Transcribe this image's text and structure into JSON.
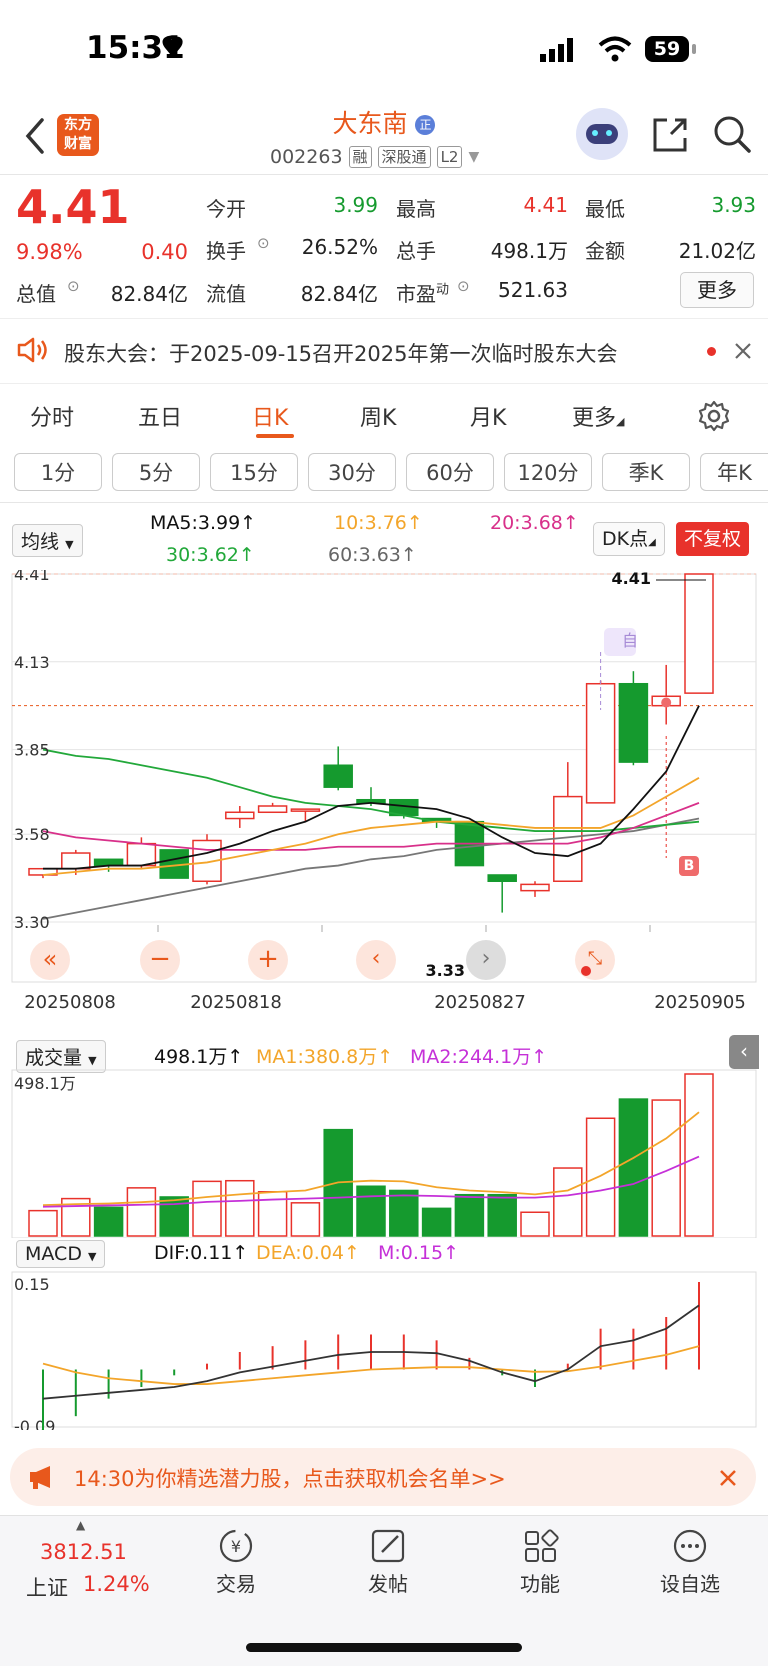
{
  "status": {
    "time": "15:31",
    "battery": "59"
  },
  "header": {
    "logo_line1": "东方",
    "logo_line2": "财富",
    "stock_name": "大东南",
    "name_badge": "正",
    "stock_code": "002263",
    "tags": [
      "融",
      "深股通",
      "L2"
    ]
  },
  "quote": {
    "price": "4.41",
    "change_pct": "9.98%",
    "change": "0.40",
    "open_label": "今开",
    "open": "3.99",
    "high_label": "最高",
    "high": "4.41",
    "low_label": "最低",
    "low": "3.93",
    "turnover_label": "换手",
    "turnover": "26.52%",
    "volume_label": "总手",
    "volume": "498.1万",
    "amount_label": "金额",
    "amount": "21.02亿",
    "mktcap_label": "总值",
    "mktcap": "82.84亿",
    "float_label": "流值",
    "float_cap": "82.84亿",
    "pe_label": "市盈",
    "pe_sup": "动",
    "pe": "521.63",
    "more": "更多"
  },
  "notice": {
    "text": "股东大会：于2025-09-15召开2025年第一次临时股东大会"
  },
  "period_tabs": [
    "分时",
    "五日",
    "日K",
    "周K",
    "月K",
    "更多"
  ],
  "active_period": "日K",
  "interval_buttons": [
    "1分",
    "5分",
    "15分",
    "30分",
    "60分",
    "120分",
    "季K",
    "年K"
  ],
  "ma": {
    "selector": "均线",
    "ma5": "MA5:3.99↑",
    "ma10": "10:3.76↑",
    "ma20": "20:3.68↑",
    "ma30": "30:3.62↑",
    "ma60": "60:3.63↑",
    "dk": "DK点",
    "fq": "不复权"
  },
  "kline": {
    "y_labels": [
      "4.41",
      "4.13",
      "3.85",
      "3.58",
      "3.30"
    ],
    "x_labels": [
      "20250808",
      "20250818",
      "20250827",
      "20250905"
    ],
    "high_marker": "4.41",
    "low_marker": "3.33",
    "zi": "自",
    "b_marker": "B"
  },
  "volume": {
    "selector": "成交量",
    "value": "498.1万↑",
    "ma1": "MA1:380.8万↑",
    "ma2": "MA2:244.1万↑",
    "y_max": "498.1万"
  },
  "macd": {
    "selector": "MACD",
    "dif": "DIF:0.11↑",
    "dea": "DEA:0.04↑",
    "m": "M:0.15↑",
    "y_max": "0.15",
    "y_min": "-0.09"
  },
  "promo": {
    "text": "14:30为你精选潜力股，点击获取机会名单>>"
  },
  "bottom_nav": {
    "index_value": "3812.51",
    "index_name": "上证",
    "index_change": "1.24%",
    "items": [
      "交易",
      "发帖",
      "功能",
      "设自选"
    ]
  },
  "colors": {
    "up": "#e8322b",
    "down": "#159a2e",
    "accent": "#e8581c",
    "ma5": "#111111",
    "ma10": "#f3a52a",
    "ma20": "#d8308a",
    "ma30": "#22a83a",
    "ma60": "#777777"
  },
  "chart_data": {
    "type": "candlestick",
    "dates": [
      "20250808",
      "",
      "",
      "",
      "",
      "20250818",
      "",
      "",
      "",
      "",
      "",
      "",
      "",
      "20250827",
      "",
      "",
      "",
      "",
      "",
      "20250905"
    ],
    "ohlc": [
      [
        3.45,
        3.47,
        3.44,
        3.47
      ],
      [
        3.47,
        3.53,
        3.45,
        3.52
      ],
      [
        3.5,
        3.5,
        3.46,
        3.48
      ],
      [
        3.48,
        3.57,
        3.47,
        3.55
      ],
      [
        3.53,
        3.53,
        3.44,
        3.44
      ],
      [
        3.43,
        3.58,
        3.42,
        3.56
      ],
      [
        3.63,
        3.67,
        3.6,
        3.65
      ],
      [
        3.65,
        3.68,
        3.65,
        3.67
      ],
      [
        3.66,
        3.66,
        3.62,
        3.66
      ],
      [
        3.8,
        3.86,
        3.72,
        3.73
      ],
      [
        3.69,
        3.73,
        3.67,
        3.68
      ],
      [
        3.69,
        3.69,
        3.63,
        3.64
      ],
      [
        3.63,
        3.63,
        3.6,
        3.62
      ],
      [
        3.62,
        3.62,
        3.48,
        3.48
      ],
      [
        3.45,
        3.45,
        3.33,
        3.43
      ],
      [
        3.4,
        3.43,
        3.38,
        3.42
      ],
      [
        3.43,
        3.81,
        3.43,
        3.7
      ],
      [
        3.68,
        4.07,
        3.68,
        4.06
      ],
      [
        4.06,
        4.1,
        3.8,
        3.81
      ],
      [
        3.99,
        4.12,
        3.93,
        4.02
      ],
      [
        4.03,
        4.41,
        4.03,
        4.41
      ]
    ],
    "ma5": [
      3.47,
      3.47,
      3.48,
      3.48,
      3.5,
      3.52,
      3.55,
      3.59,
      3.62,
      3.67,
      3.68,
      3.67,
      3.66,
      3.63,
      3.57,
      3.52,
      3.51,
      3.55,
      3.66,
      3.78,
      3.99
    ],
    "ma10": [
      3.45,
      3.46,
      3.47,
      3.47,
      3.48,
      3.49,
      3.51,
      3.53,
      3.55,
      3.58,
      3.6,
      3.61,
      3.62,
      3.62,
      3.61,
      3.6,
      3.6,
      3.6,
      3.64,
      3.7,
      3.76
    ],
    "ma20": [
      3.59,
      3.57,
      3.56,
      3.55,
      3.54,
      3.53,
      3.53,
      3.53,
      3.53,
      3.54,
      3.54,
      3.54,
      3.55,
      3.55,
      3.55,
      3.55,
      3.55,
      3.57,
      3.6,
      3.64,
      3.68
    ],
    "ma30": [
      3.85,
      3.83,
      3.82,
      3.8,
      3.78,
      3.76,
      3.73,
      3.7,
      3.68,
      3.67,
      3.66,
      3.64,
      3.62,
      3.61,
      3.6,
      3.59,
      3.59,
      3.59,
      3.6,
      3.61,
      3.62
    ],
    "ma60": [
      3.31,
      3.33,
      3.35,
      3.37,
      3.39,
      3.41,
      3.43,
      3.45,
      3.47,
      3.48,
      3.5,
      3.51,
      3.53,
      3.54,
      3.55,
      3.56,
      3.57,
      3.58,
      3.59,
      3.61,
      3.63
    ],
    "volume": [
      78,
      115,
      88,
      148,
      120,
      168,
      170,
      136,
      102,
      327,
      153,
      140,
      85,
      127,
      127,
      73,
      209,
      362,
      421,
      418,
      498.1
    ],
    "vol_ma1": [
      95,
      98,
      100,
      104,
      110,
      120,
      128,
      135,
      140,
      165,
      170,
      168,
      150,
      140,
      135,
      128,
      140,
      185,
      240,
      300,
      380.8
    ],
    "vol_ma2": [
      90,
      92,
      94,
      96,
      98,
      105,
      108,
      112,
      115,
      118,
      122,
      125,
      123,
      120,
      118,
      118,
      125,
      140,
      160,
      200,
      244.1
    ],
    "dif": [
      -0.05,
      -0.045,
      -0.04,
      -0.035,
      -0.03,
      -0.02,
      -0.005,
      0.005,
      0.015,
      0.025,
      0.03,
      0.03,
      0.028,
      0.015,
      -0.005,
      -0.02,
      0.0,
      0.04,
      0.05,
      0.07,
      0.11
    ],
    "dea": [
      0.01,
      -0.005,
      -0.015,
      -0.02,
      -0.025,
      -0.025,
      -0.02,
      -0.015,
      -0.01,
      -0.005,
      0.0,
      0.002,
      0.004,
      0.004,
      0.0,
      -0.004,
      -0.003,
      0.005,
      0.015,
      0.025,
      0.04
    ],
    "macd_m": [
      -0.12,
      -0.08,
      -0.05,
      -0.03,
      -0.01,
      0.01,
      0.03,
      0.04,
      0.05,
      0.06,
      0.06,
      0.06,
      0.05,
      0.02,
      -0.01,
      -0.03,
      0.01,
      0.07,
      0.07,
      0.09,
      0.15
    ]
  }
}
